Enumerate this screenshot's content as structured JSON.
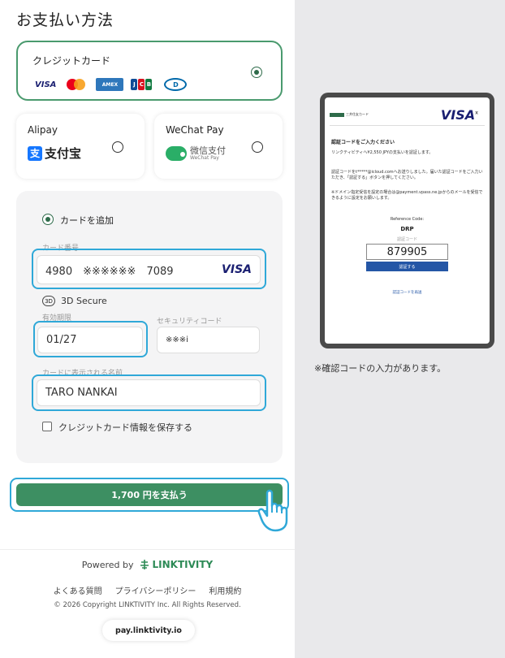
{
  "page": {
    "title": "お支払い方法"
  },
  "methods": {
    "card": {
      "label": "クレジットカード",
      "selected": true,
      "brands": [
        "VISA",
        "Mastercard",
        "AMERICAN EXPRESS",
        "JCB",
        "Diners Club"
      ]
    },
    "alipay": {
      "label": "Alipay",
      "logo_text": "支付宝",
      "logo_mark": "支"
    },
    "wechat": {
      "label": "WeChat Pay",
      "logo_text": "微信支付",
      "logo_sub": "WeChat Pay"
    }
  },
  "form": {
    "add_card_label": "カードを追加",
    "card_number_label": "カード番号",
    "card_number_value": "4980　※※※※※※　7089",
    "card_brand": "VISA",
    "secure_icon_text": "3D",
    "secure_label": "3D Secure",
    "expiry_label": "有効期限",
    "expiry_value": "01/27",
    "cvc_label": "セキュリティコード",
    "cvc_value": "※※※i",
    "name_label": "カードに表示される名前",
    "name_value": "TARO NANKAI",
    "save_label": "クレジットカード情報を保存する"
  },
  "pay_button": {
    "label": "1,700 円を支払う"
  },
  "footer": {
    "powered_by": "Powered by",
    "brand": "LINKTIVITY",
    "links": [
      "よくある質問",
      "プライバシーポリシー",
      "利用規約"
    ],
    "copyright": "© 2026 Copyright LINKTIVITY Inc. All Rights Reserved.",
    "domain": "pay.linktivity.io"
  },
  "verification": {
    "bank_name": "三井住友カード",
    "visa": "VISA",
    "title": "認証コードをご入力ください",
    "line1": "リンクティビティへ¥2,550 JPYの支払いを認証します。",
    "line2": "認証コードをt*****@icloud.comへお送りしました。届いた認証コードをご入力いただき、「認証する」ボタンを押してください。",
    "line3": "※ドメイン指定受信を設定の場合は@payment.vpass.ne.jpからのメールを受信できるように設定をお願いします。",
    "reference_label": "Reference Code:",
    "reference_code": "DRP",
    "code_label": "認証コード",
    "code_value": "879905",
    "submit": "認証する",
    "resend": "認証コードを再送",
    "note": "※確認コードの入力があります。"
  },
  "colors": {
    "accent_green": "#3d8f62",
    "highlight_blue": "#2fa8d8",
    "visa_blue": "#1a1f71"
  }
}
